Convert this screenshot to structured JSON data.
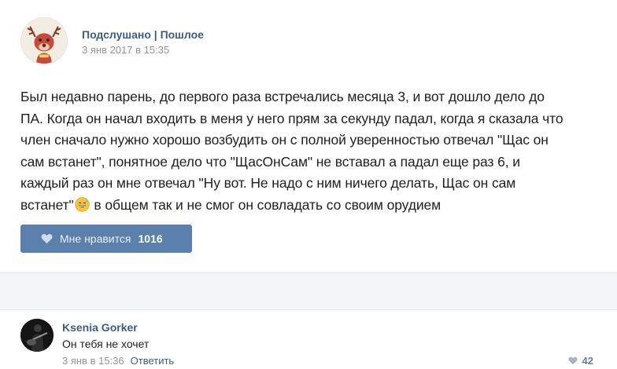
{
  "post": {
    "group_name": "Подслушано | Пошлое",
    "date": "3 янв 2017 в 15:35",
    "text_lines": [
      "Был недавно парень, до первого раза встречались месяца 3, и вот дошло дело до",
      "ПА. Когда он начал входить в меня у него прям за секунду падал, когда я сказала что",
      "член сначало нужно хорошо возбудить он с полной уверенностью отвечал \"Щас он",
      "сам встанет\", понятное дело что \"ЩасОнСам\" не вставал а падал еще раз 6, и",
      "каждый раз он мне отвечал \"Ну вот. Не надо с ним ничего делать, Щас он сам"
    ],
    "last_line_before_emoji": "встанет\"",
    "last_line_after_emoji": " в общем так и не смог он совладать со своим орудием",
    "emoji_icon": "grinning-sweat-emoji",
    "like_label": "Мне нравится",
    "like_count": "1016"
  },
  "comment": {
    "author": "Ksenia Gorker",
    "text": "Он тебя не хочет",
    "date": "3 янв в 15:36",
    "reply_label": "Ответить",
    "like_count": "42"
  },
  "colors": {
    "link": "#3b5d85",
    "like_button": "#5b80ac",
    "muted": "#939393",
    "divider_bg": "#f4f5f7"
  }
}
